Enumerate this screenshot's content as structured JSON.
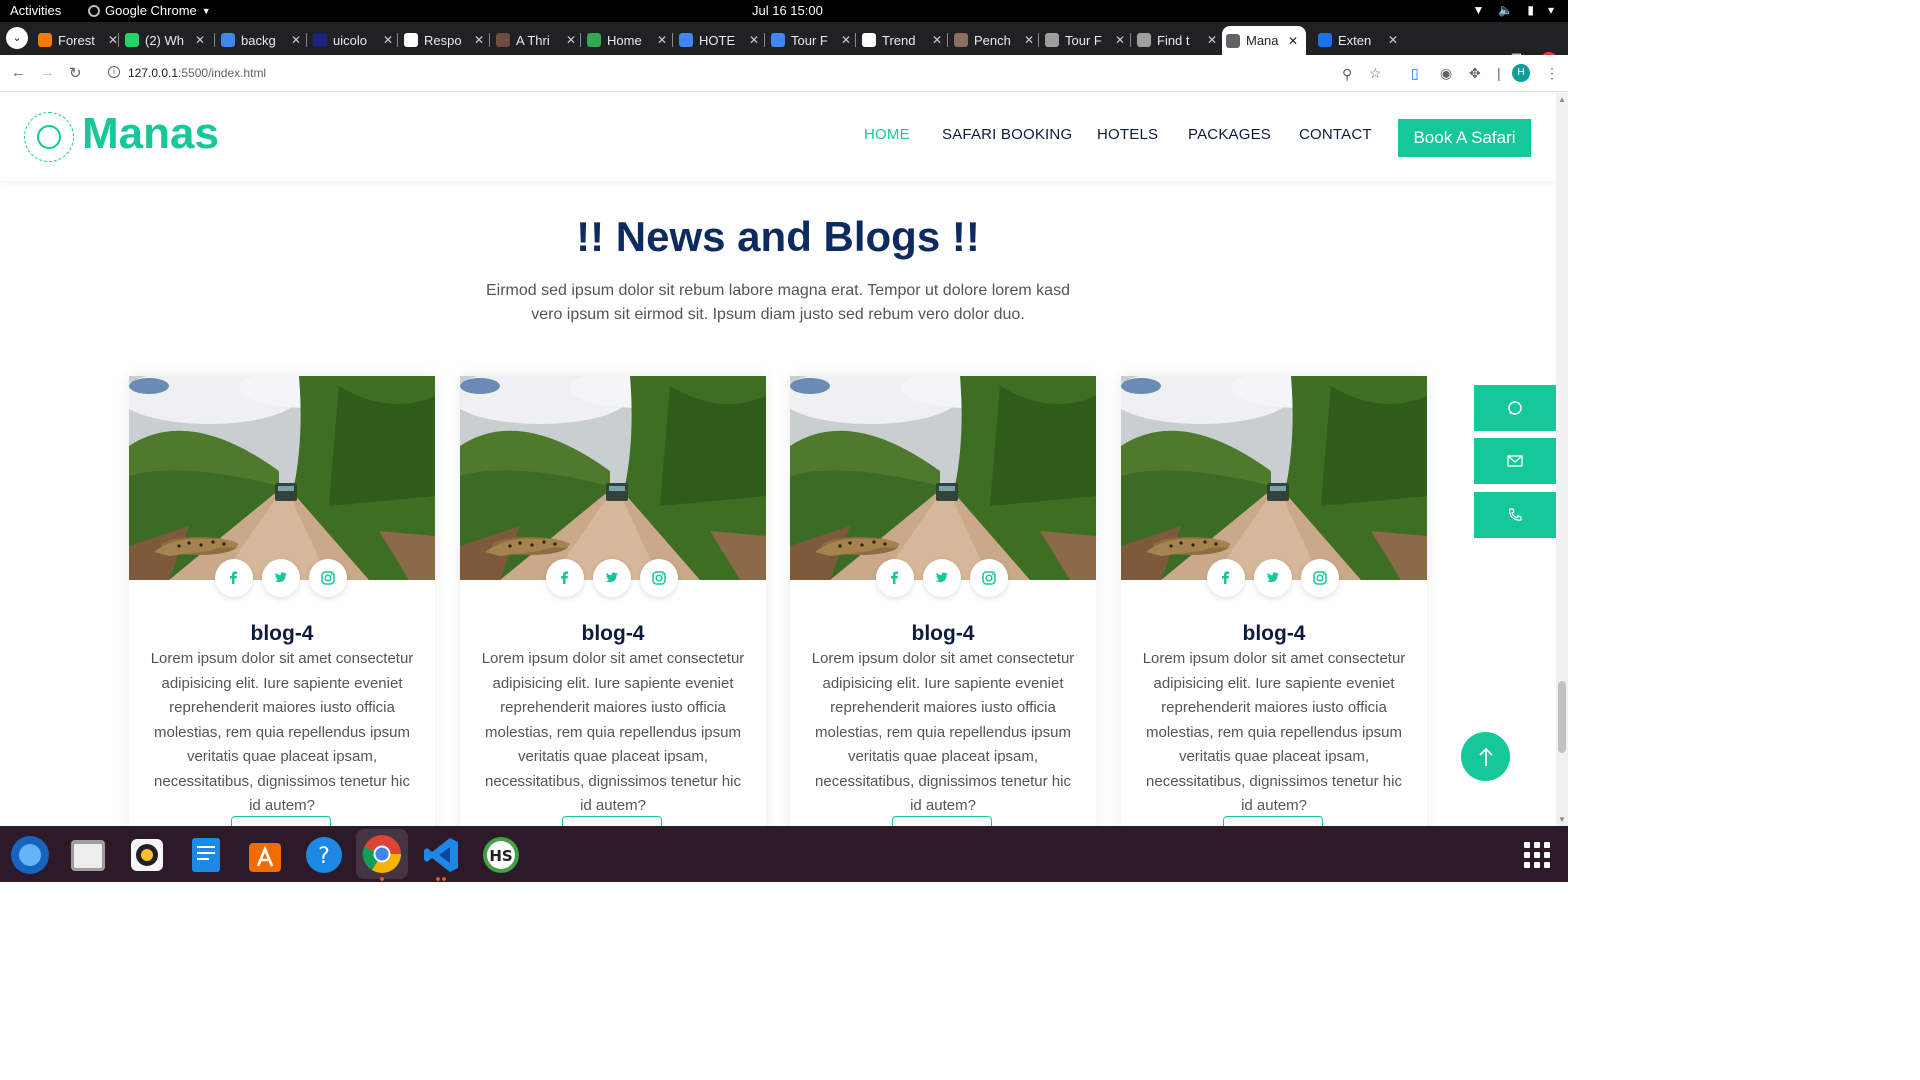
{
  "system_bar": {
    "activities": "Activities",
    "app_name": "Google Chrome",
    "clock": "Jul 16  15:00"
  },
  "browser": {
    "tabs": [
      {
        "label": "Forest",
        "favicon_color": "#f57c00"
      },
      {
        "label": "(2) Wh",
        "favicon_color": "#25d366"
      },
      {
        "label": "backg",
        "favicon_color": "#4285f4"
      },
      {
        "label": "uicolo",
        "favicon_color": "#1a237e"
      },
      {
        "label": "Respo",
        "favicon_color": "#ffffff"
      },
      {
        "label": "A Thri",
        "favicon_color": "#6d4c41"
      },
      {
        "label": "Home",
        "favicon_color": "#34a853"
      },
      {
        "label": "HOTE",
        "favicon_color": "#4285f4"
      },
      {
        "label": "Tour F",
        "favicon_color": "#4285f4"
      },
      {
        "label": "Trend",
        "favicon_color": "#ffffff"
      },
      {
        "label": "Pench",
        "favicon_color": "#8d6e63"
      },
      {
        "label": "Tour F",
        "favicon_color": "#9e9e9e"
      },
      {
        "label": "Find t",
        "favicon_color": "#9e9e9e"
      },
      {
        "label": "Mana",
        "favicon_color": "#5f6368"
      },
      {
        "label": "Exten",
        "favicon_color": "#1a73e8"
      }
    ],
    "active_tab_index": 13,
    "url_host": "127.0.0.1",
    "url_path": ":5500/index.html"
  },
  "site": {
    "logo_text": "Manas",
    "nav": [
      {
        "label": "HOME",
        "active": true
      },
      {
        "label": "SAFARI BOOKING",
        "active": false
      },
      {
        "label": "HOTELS",
        "active": false
      },
      {
        "label": "PACKAGES",
        "active": false
      },
      {
        "label": "CONTACT",
        "active": false
      }
    ],
    "cta_label": "Book A Safari",
    "accent_color": "#16c79a",
    "heading_color": "#0d2b5e"
  },
  "blog_section": {
    "title": "!! News and Blogs !!",
    "subtitle": "Eirmod sed ipsum dolor sit rebum labore magna erat. Tempor ut dolore lorem kasd vero ipsum sit eirmod sit. Ipsum diam justo sed rebum vero dolor duo.",
    "cards": [
      {
        "title": "blog-4",
        "text": "Lorem ipsum dolor sit amet consectetur adipisicing elit. Iure sapiente eveniet reprehenderit maiores iusto officia molestias, rem quia repellendus ipsum veritatis quae placeat ipsam, necessitatibus, dignissimos tenetur hic id autem?"
      },
      {
        "title": "blog-4",
        "text": "Lorem ipsum dolor sit amet consectetur adipisicing elit. Iure sapiente eveniet reprehenderit maiores iusto officia molestias, rem quia repellendus ipsum veritatis quae placeat ipsam, necessitatibus, dignissimos tenetur hic id autem?"
      },
      {
        "title": "blog-4",
        "text": "Lorem ipsum dolor sit amet consectetur adipisicing elit. Iure sapiente eveniet reprehenderit maiores iusto officia molestias, rem quia repellendus ipsum veritatis quae placeat ipsam, necessitatibus, dignissimos tenetur hic id autem?"
      },
      {
        "title": "blog-4",
        "text": "Lorem ipsum dolor sit amet consectetur adipisicing elit. Iure sapiente eveniet reprehenderit maiores iusto officia molestias, rem quia repellendus ipsum veritatis quae placeat ipsam, necessitatibus, dignissimos tenetur hic id autem?"
      }
    ],
    "social_icons": [
      "facebook-icon",
      "twitter-icon",
      "instagram-icon"
    ]
  },
  "floating_contact": [
    "whatsapp-icon",
    "mail-icon",
    "phone-icon"
  ],
  "dock": [
    "thunderbird",
    "files",
    "rhythmbox",
    "text-editor",
    "app-center",
    "help",
    "chrome",
    "vscode",
    "hs-app"
  ]
}
